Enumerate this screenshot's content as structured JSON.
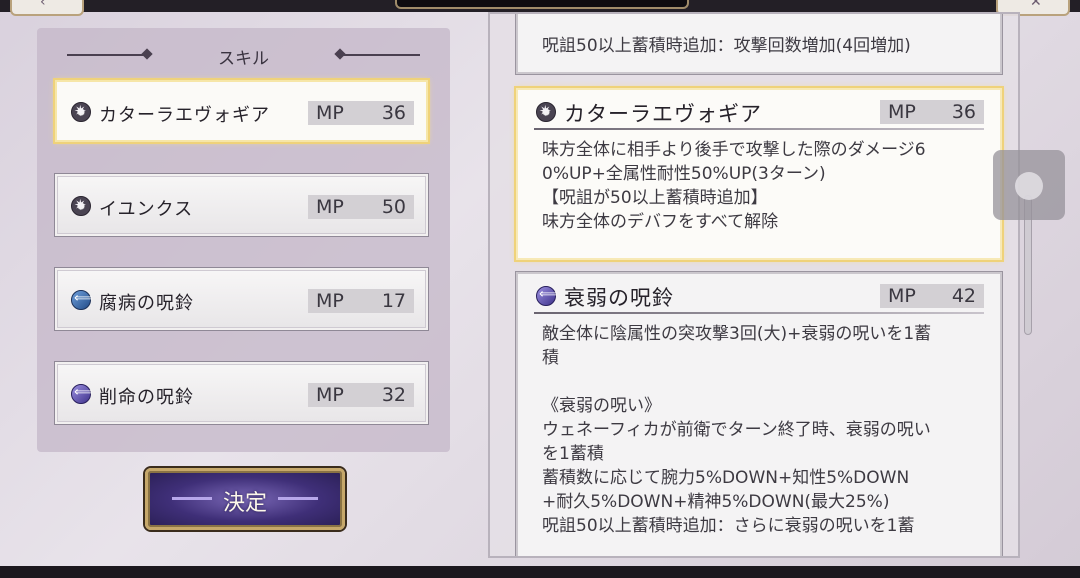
{
  "corner": {
    "left_glyph": "‹",
    "right_glyph": "✕"
  },
  "panel": {
    "title": "スキル"
  },
  "skills": [
    {
      "name": "カターラエヴォギア",
      "mp_label": "MP",
      "mp": "36",
      "icon": "burst-icon"
    },
    {
      "name": "イユンクス",
      "mp_label": "MP",
      "mp": "50",
      "icon": "burst-icon"
    },
    {
      "name": "腐病の呪鈴",
      "mp_label": "MP",
      "mp": "17",
      "icon": "arrow-icon-blue"
    },
    {
      "name": "削命の呪鈴",
      "mp_label": "MP",
      "mp": "32",
      "icon": "arrow-icon-purple"
    }
  ],
  "decide_label": "決定",
  "details": {
    "partial_top": "呪詛50以上蓄積時追加：攻撃回数増加(4回増加)",
    "card1": {
      "name": "カターラエヴォギア",
      "mp_label": "MP",
      "mp": "36",
      "desc": "味方全体に相手より後手で攻撃した際のダメージ6\n0%UP+全属性耐性50%UP(3ターン)\n【呪詛が50以上蓄積時追加】\n味方全体のデバフをすべて解除"
    },
    "card2": {
      "name": "衰弱の呪鈴",
      "mp_label": "MP",
      "mp": "42",
      "desc": "敵全体に陰属性の突攻撃3回(大)+衰弱の呪いを1蓄\n積\n\n《衰弱の呪い》\nウェネーフィカが前衛でターン終了時、衰弱の呪い\nを1蓄積\n蓄積数に応じて腕力5%DOWN+知性5%DOWN\n+耐久5%DOWN+精神5%DOWN(最大25%)\n呪詛50以上蓄積時追加：さらに衰弱の呪いを1蓄"
    }
  }
}
